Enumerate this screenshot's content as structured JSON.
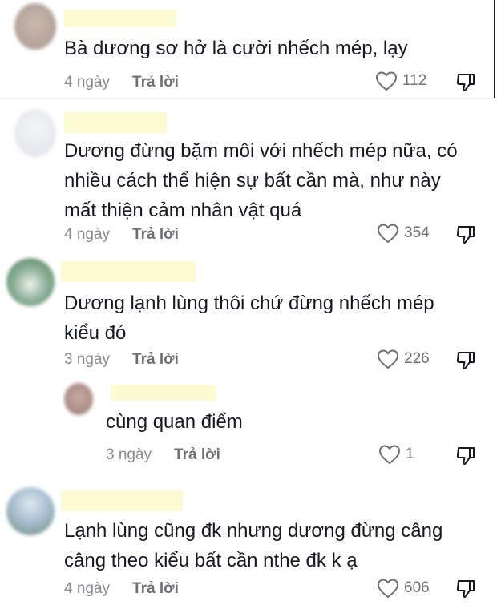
{
  "comments": [
    {
      "text": "Bà dương sơ hở là cười nhếch mép, lạy",
      "age": "4 ngày",
      "reply_label": "Trả lời",
      "likes": "112"
    },
    {
      "text": "Dương đừng bặm môi với nhếch mép nữa, có\nnhiều cách thể hiện sự bất cần mà, như này\nmất thiện cảm nhân vật quá",
      "age": "4 ngày",
      "reply_label": "Trả lời",
      "likes": "354"
    },
    {
      "text": "Dương lạnh lùng thôi chứ đừng nhếch mép\nkiểu đó",
      "age": "3 ngày",
      "reply_label": "Trả lời",
      "likes": "226"
    },
    {
      "text": "cùng quan điểm",
      "age": "3 ngày",
      "reply_label": "Trả lời",
      "likes": "1"
    },
    {
      "text": "Lạnh lùng cũng đk nhưng dương đừng câng\ncâng theo kiểu bất cần nthe đk k ạ",
      "age": "4 ngày",
      "reply_label": "Trả lời",
      "likes": "606"
    }
  ],
  "icons": {
    "like": "heart-outline-icon",
    "dislike": "thumbs-down-icon"
  },
  "colors": {
    "username_redaction": "#fdfbd3",
    "meta_text": "#8a8b91"
  }
}
